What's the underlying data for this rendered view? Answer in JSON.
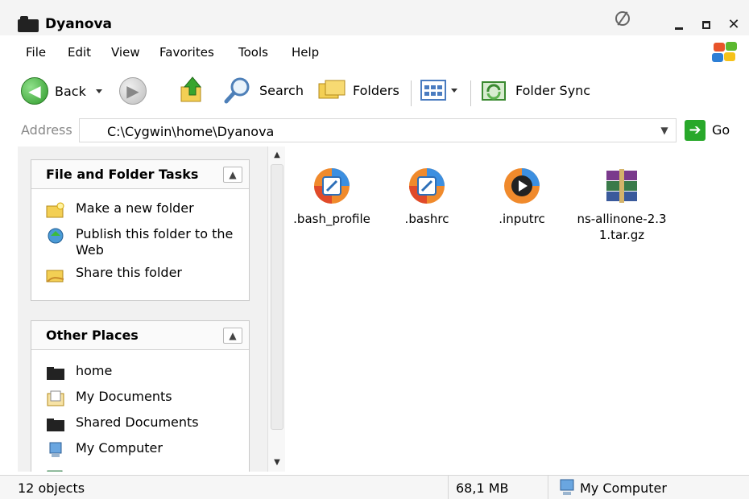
{
  "window": {
    "title": "Dyanova"
  },
  "menu": [
    "File",
    "Edit",
    "View",
    "Favorites",
    "Tools",
    "Help"
  ],
  "toolbar": {
    "back_label": "Back",
    "search_label": "Search",
    "folders_label": "Folders",
    "folder_sync_label": "Folder Sync"
  },
  "address": {
    "label": "Address",
    "value": "C:\\Cygwin\\home\\Dyanova",
    "go_label": "Go"
  },
  "file_folder_tasks": {
    "title": "File and Folder Tasks",
    "items": [
      "Make a new folder",
      "Publish this folder to the Web",
      "Share this folder"
    ]
  },
  "other_places": {
    "title": "Other Places",
    "items": [
      "home",
      "My Documents",
      "Shared Documents",
      "My Computer"
    ]
  },
  "files": [
    {
      "name": ".bash_profile",
      "icon": "document-edit-icon"
    },
    {
      "name": ".bashrc",
      "icon": "document-edit-icon"
    },
    {
      "name": ".inputrc",
      "icon": "media-player-icon"
    },
    {
      "name": "ns-allinone-2.31.tar.gz",
      "icon": "winrar-archive-icon"
    }
  ],
  "status": {
    "objects": "12 objects",
    "size": "68,1 MB",
    "location": "My Computer"
  },
  "colors": {
    "go_green": "#28a82a",
    "back_green": "#2e9a2a"
  }
}
